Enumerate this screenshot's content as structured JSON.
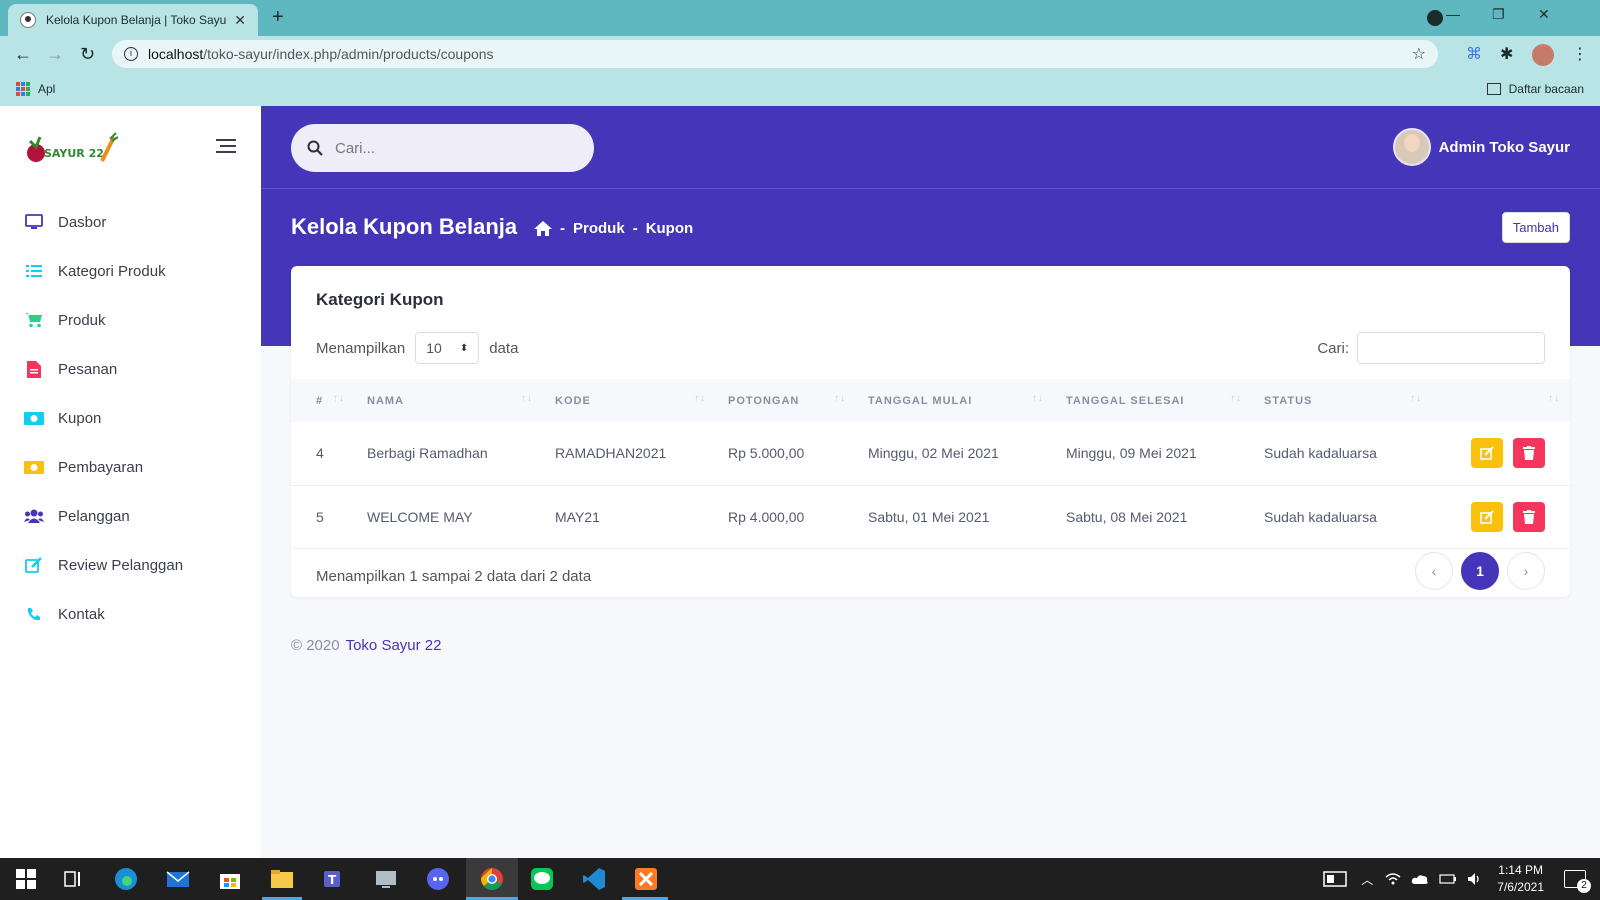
{
  "browser": {
    "tab_title": "Kelola Kupon Belanja | Toko Sayur 22",
    "url_host": "localhost",
    "url_path": "/toko-sayur/index.php/admin/products/coupons",
    "bookmarks_apps": "Apl",
    "reading_list": "Daftar bacaan"
  },
  "sidebar": {
    "logo_text": "SAYUR 22",
    "items": [
      {
        "label": "Dasbor",
        "icon": "monitor-icon",
        "color": "#4535b8"
      },
      {
        "label": "Kategori Produk",
        "icon": "list-icon",
        "color": "#11cdef"
      },
      {
        "label": "Produk",
        "icon": "cart-icon",
        "color": "#2dce89"
      },
      {
        "label": "Pesanan",
        "icon": "file-icon",
        "color": "#f5365c"
      },
      {
        "label": "Kupon",
        "icon": "money-icon",
        "color": "#11cdef"
      },
      {
        "label": "Pembayaran",
        "icon": "money-icon",
        "color": "#f9c00c"
      },
      {
        "label": "Pelanggan",
        "icon": "users-icon",
        "color": "#4535b8"
      },
      {
        "label": "Review Pelanggan",
        "icon": "edit-icon",
        "color": "#11cdef"
      },
      {
        "label": "Kontak",
        "icon": "phone-icon",
        "color": "#11cdef"
      }
    ]
  },
  "header": {
    "search_placeholder": "Cari...",
    "user_name": "Admin Toko Sayur"
  },
  "page": {
    "title": "Kelola Kupon Belanja",
    "breadcrumb": [
      "Produk",
      "Kupon"
    ],
    "add_button": "Tambah"
  },
  "card": {
    "title": "Kategori Kupon",
    "length_prefix": "Menampilkan",
    "length_value": "10",
    "length_suffix": "data",
    "filter_label": "Cari:",
    "columns": [
      "#",
      "NAMA",
      "KODE",
      "POTONGAN",
      "TANGGAL MULAI",
      "TANGGAL SELESAI",
      "STATUS",
      ""
    ],
    "rows": [
      {
        "no": "4",
        "nama": "Berbagi Ramadhan",
        "kode": "RAMADHAN2021",
        "potongan": "Rp 5.000,00",
        "mulai": "Minggu, 02 Mei 2021",
        "selesai": "Minggu, 09 Mei 2021",
        "status": "Sudah kadaluarsa"
      },
      {
        "no": "5",
        "nama": "WELCOME MAY",
        "kode": "MAY21",
        "potongan": "Rp 4.000,00",
        "mulai": "Sabtu, 01 Mei 2021",
        "selesai": "Sabtu, 08 Mei 2021",
        "status": "Sudah kadaluarsa"
      }
    ],
    "info": "Menampilkan 1 sampai 2 data dari 2 data",
    "pager_prev": "‹",
    "pager_current": "1",
    "pager_next": "›"
  },
  "footer": {
    "copyright": "© 2020",
    "brand": "Toko Sayur 22"
  },
  "taskbar": {
    "time": "1:14 PM",
    "date": "7/6/2021",
    "notifications": "2"
  },
  "colors": {
    "primary": "#4535b8",
    "edit": "#f9c00c",
    "delete": "#f5365c"
  }
}
